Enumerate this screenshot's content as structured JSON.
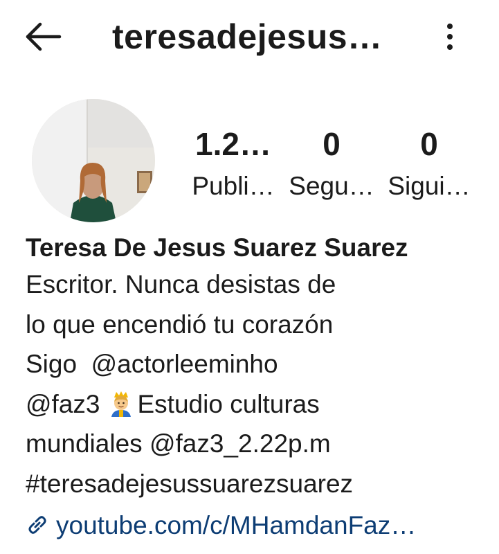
{
  "header": {
    "username": "teresadejesus…",
    "back_icon": "arrow-left-icon",
    "more_icon": "more-vertical-icon"
  },
  "profile": {
    "avatar_icon": "profile-photo",
    "stats": [
      {
        "value": "1.2…",
        "label": "Publi…"
      },
      {
        "value": "0",
        "label": "Segu…"
      },
      {
        "value": "0",
        "label": "Sigui…"
      }
    ]
  },
  "bio": {
    "full_name": "Teresa De Jesus Suarez Suarez",
    "line1": "Escritor. Nunca desistas de",
    "line2": "lo que encendió tu corazón",
    "line3_prefix": "Sigo  ",
    "line3_mention": "@actorleeminho",
    "line4_mention": "@faz3",
    "line4_emoji": "prince-emoji",
    "line4_text": "Estudio culturas",
    "line5_text": "mundiales ",
    "line5_mention": "@faz3_2.22p.m",
    "line6_hashtag": "#teresadejesussuarezsuarez",
    "link_icon": "link-icon",
    "website": "youtube.com/c/MHamdanFaz…"
  },
  "colors": {
    "link": "#0d3d74",
    "text": "#1b1b1b",
    "background": "#ffffff"
  }
}
